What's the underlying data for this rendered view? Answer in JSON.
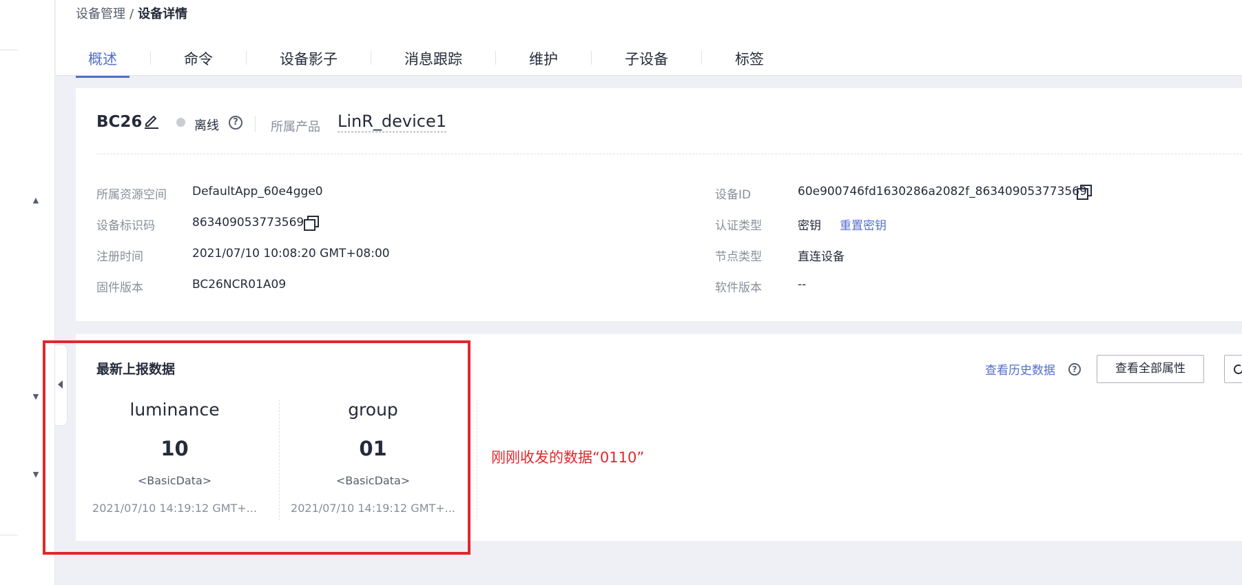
{
  "breadcrumb": {
    "parent": "设备管理",
    "separator": "/",
    "current": "设备详情"
  },
  "tabs": [
    {
      "label": "概述",
      "active": true
    },
    {
      "label": "命令"
    },
    {
      "label": "设备影子"
    },
    {
      "label": "消息跟踪"
    },
    {
      "label": "维护"
    },
    {
      "label": "子设备"
    },
    {
      "label": "标签"
    }
  ],
  "device": {
    "name": "BC26",
    "status": "离线",
    "product_label": "所属产品",
    "product_name": "LinR_device1"
  },
  "info": {
    "left": [
      {
        "label": "所属资源空间",
        "value": "DefaultApp_60e4gge0"
      },
      {
        "label": "设备标识码",
        "value": "863409053773569"
      },
      {
        "label": "注册时间",
        "value": "2021/07/10 10:08:20 GMT+08:00"
      },
      {
        "label": "固件版本",
        "value": "BC26NCR01A09"
      }
    ],
    "right": [
      {
        "label": "设备ID",
        "value": "60e900746fd1630286a2082f_863409053773569"
      },
      {
        "label": "认证类型",
        "value": "密钥",
        "link": "重置密钥"
      },
      {
        "label": "节点类型",
        "value": "直连设备"
      },
      {
        "label": "软件版本",
        "value": "--"
      }
    ]
  },
  "latest": {
    "title": "最新上报数据",
    "history_link": "查看历史数据",
    "all_props_button": "查看全部属性",
    "properties": [
      {
        "name": "luminance",
        "value": "10",
        "type": "<BasicData>",
        "time": "2021/07/10 14:19:12 GMT+..."
      },
      {
        "name": "group",
        "value": "01",
        "type": "<BasicData>",
        "time": "2021/07/10 14:19:12 GMT+..."
      }
    ]
  },
  "annotation": {
    "text": "刚刚收发的数据“0110”",
    "color": "#e0272c"
  },
  "colors": {
    "accent": "#526ecc",
    "offline_dot": "#c9ccd3",
    "annotation": "#e0272c"
  },
  "icons": [
    "edit-icon",
    "help-icon",
    "copy-icon",
    "refresh-icon",
    "caret-up-icon",
    "caret-down-icon",
    "collapse-left-icon"
  ]
}
